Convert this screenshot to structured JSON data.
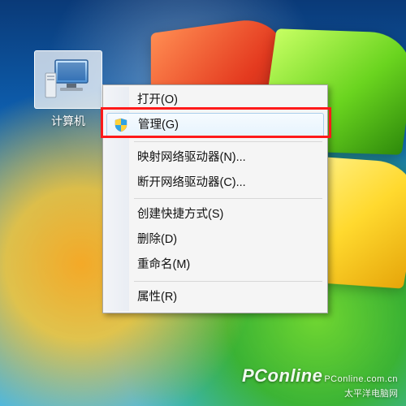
{
  "desktop": {
    "icon_label": "计算机"
  },
  "context_menu": {
    "items": {
      "open": "打开(O)",
      "manage": "管理(G)",
      "map_drive": "映射网络驱动器(N)...",
      "disconnect": "断开网络驱动器(C)...",
      "shortcut": "创建快捷方式(S)",
      "delete": "删除(D)",
      "rename": "重命名(M)",
      "properties": "属性(R)"
    },
    "highlighted": "manage"
  },
  "watermark": {
    "main": "PConline",
    "sub": "PConline.com.cn",
    "cn": "太平洋电脑网"
  }
}
